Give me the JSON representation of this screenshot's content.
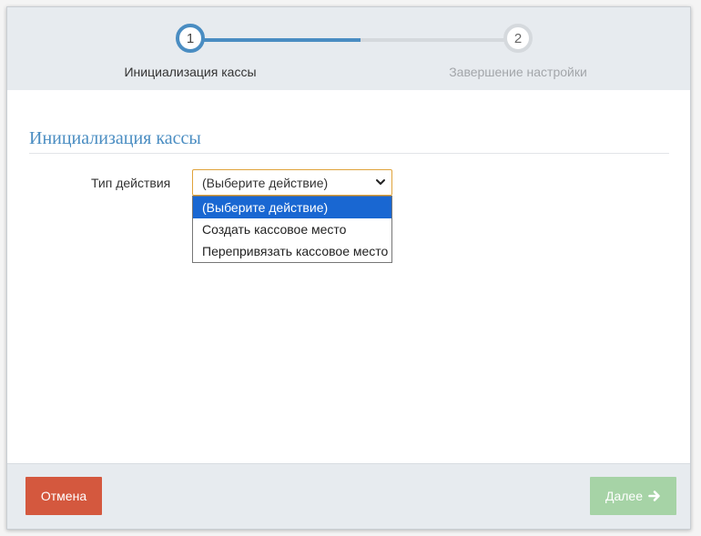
{
  "stepper": {
    "steps": [
      {
        "number": "1",
        "label": "Инициализация кассы",
        "state": "active"
      },
      {
        "number": "2",
        "label": "Завершение настройки",
        "state": "inactive"
      }
    ]
  },
  "section": {
    "title": "Инициализация кассы"
  },
  "form": {
    "action_type_label": "Тип действия",
    "action_select": {
      "value": "(Выберите действие)",
      "options": [
        {
          "label": "(Выберите действие)",
          "selected": true
        },
        {
          "label": "Создать кассовое место",
          "selected": false
        },
        {
          "label": "Перепривязать кассовое место",
          "selected": false
        }
      ]
    }
  },
  "footer": {
    "cancel_label": "Отмена",
    "next_label": "Далее",
    "next_icon": "arrow-right-icon"
  },
  "colors": {
    "accent": "#4a8dc2",
    "cancel": "#d4583e",
    "next_disabled": "#a6d3a6",
    "select_border": "#e0a33b",
    "option_highlight": "#1967d2"
  }
}
